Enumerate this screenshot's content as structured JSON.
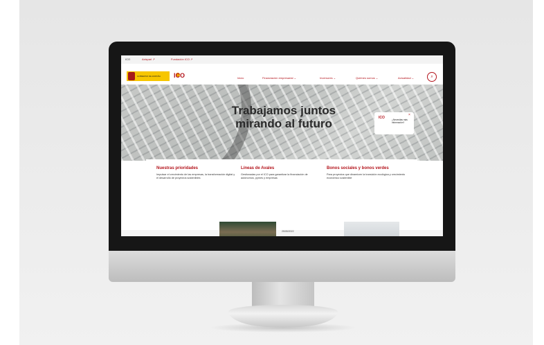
{
  "topbar": {
    "items": [
      "ICO",
      "Axisparl ↗",
      "Fundación ICO ↗"
    ]
  },
  "header": {
    "gov_logo_text": "GOBIERNO DE ESPAÑA",
    "ico_logo_text": "ICO",
    "nav": [
      "Inicio",
      "Financiación empresarial ⌄",
      "Inversores ⌄",
      "Quiénes somos ⌄",
      "Actualidad ⌄"
    ],
    "search_icon": "search-icon"
  },
  "hero": {
    "title": "Trabajamos juntos mirando al futuro"
  },
  "help": {
    "logo": "ICO",
    "question": "¿Necesitas más información?",
    "close": "×"
  },
  "cards": [
    {
      "title": "Nuestras prioridades",
      "text": "Impulsar el crecimiento de las empresas, la transformación digital y el desarrollo de proyectos sostenibles"
    },
    {
      "title": "Líneas de Avales",
      "text": "Gestionadas por el ICO para garantizar la financiación de autónomos, pymes y empresas"
    },
    {
      "title": "Bonos sociales y bonos verdes",
      "text": "Para proyectos que dinamicen la transición ecológica y crecimiento económico sostenible"
    }
  ],
  "news": {
    "date": "25/05/2022"
  },
  "colors": {
    "brand_red": "#b3121a",
    "gov_yellow": "#f7c600",
    "help_fab": "#c8102e"
  }
}
